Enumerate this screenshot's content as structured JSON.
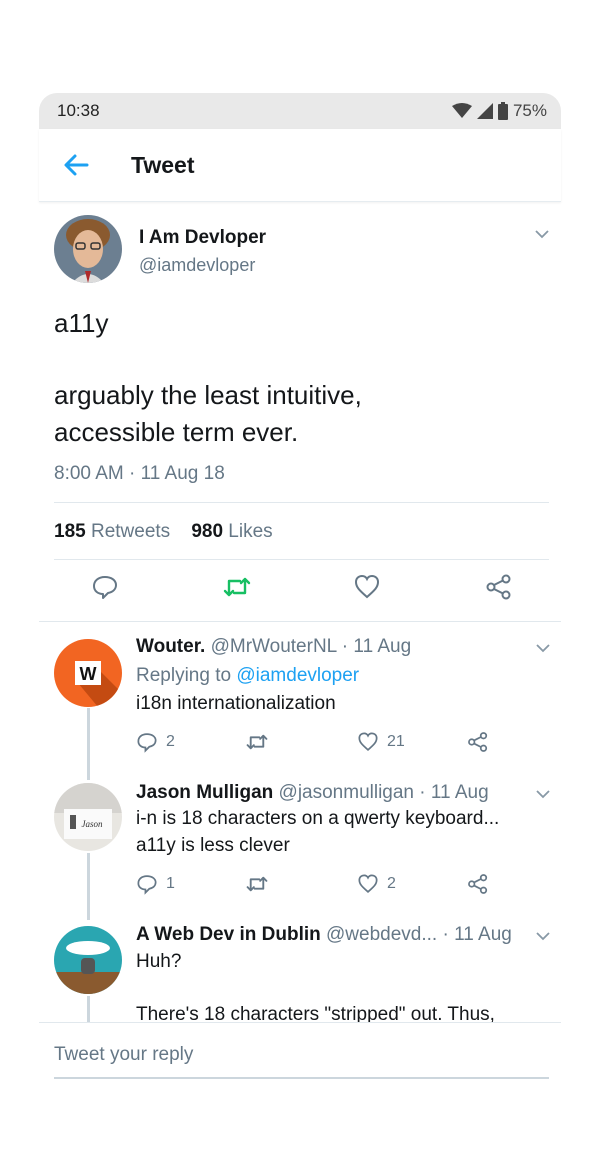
{
  "status_bar": {
    "time": "10:38",
    "battery": "75%"
  },
  "header": {
    "title": "Tweet"
  },
  "main_tweet": {
    "name": "I Am Devloper",
    "handle": "@iamdevloper",
    "text_line1": "a11y",
    "text_line2": "arguably the least intuitive,",
    "text_line3": "accessible term ever.",
    "date": "8:00 AM · 11 Aug 18",
    "retweets_count": "185",
    "retweets_label": "Retweets",
    "likes_count": "980",
    "likes_label": "Likes"
  },
  "replies": [
    {
      "name": "Wouter.",
      "meta": "@MrWouterNL · 11 Aug",
      "replying_prefix": "Replying to",
      "replying_to": "@iamdevloper",
      "text": "i18n internationalization",
      "reply_count": "2",
      "like_count": "21",
      "avatar_letter": "W"
    },
    {
      "name": "Jason Mulligan",
      "meta": "@jasonmulligan · 11 Aug",
      "text_line1": "i-n is 18 characters on a qwerty keyboard...",
      "text_line2": "a11y is less clever",
      "reply_count": "1",
      "like_count": "2"
    },
    {
      "name": "A Web Dev in Dublin",
      "meta": "@webdevd... · 11 Aug",
      "text_line1": "Huh?",
      "text_line2": "There's 18 characters \"stripped\" out. Thus,"
    }
  ],
  "reply_bar": {
    "placeholder": "Tweet your reply"
  },
  "colors": {
    "accent": "#1da1f2",
    "retweet_green": "#17bf63",
    "muted": "#657786"
  },
  "icons": [
    "wifi-icon",
    "signal-icon",
    "battery-icon",
    "back-arrow-icon",
    "chevron-down-icon",
    "reply-icon",
    "retweet-icon",
    "like-icon",
    "share-icon"
  ]
}
